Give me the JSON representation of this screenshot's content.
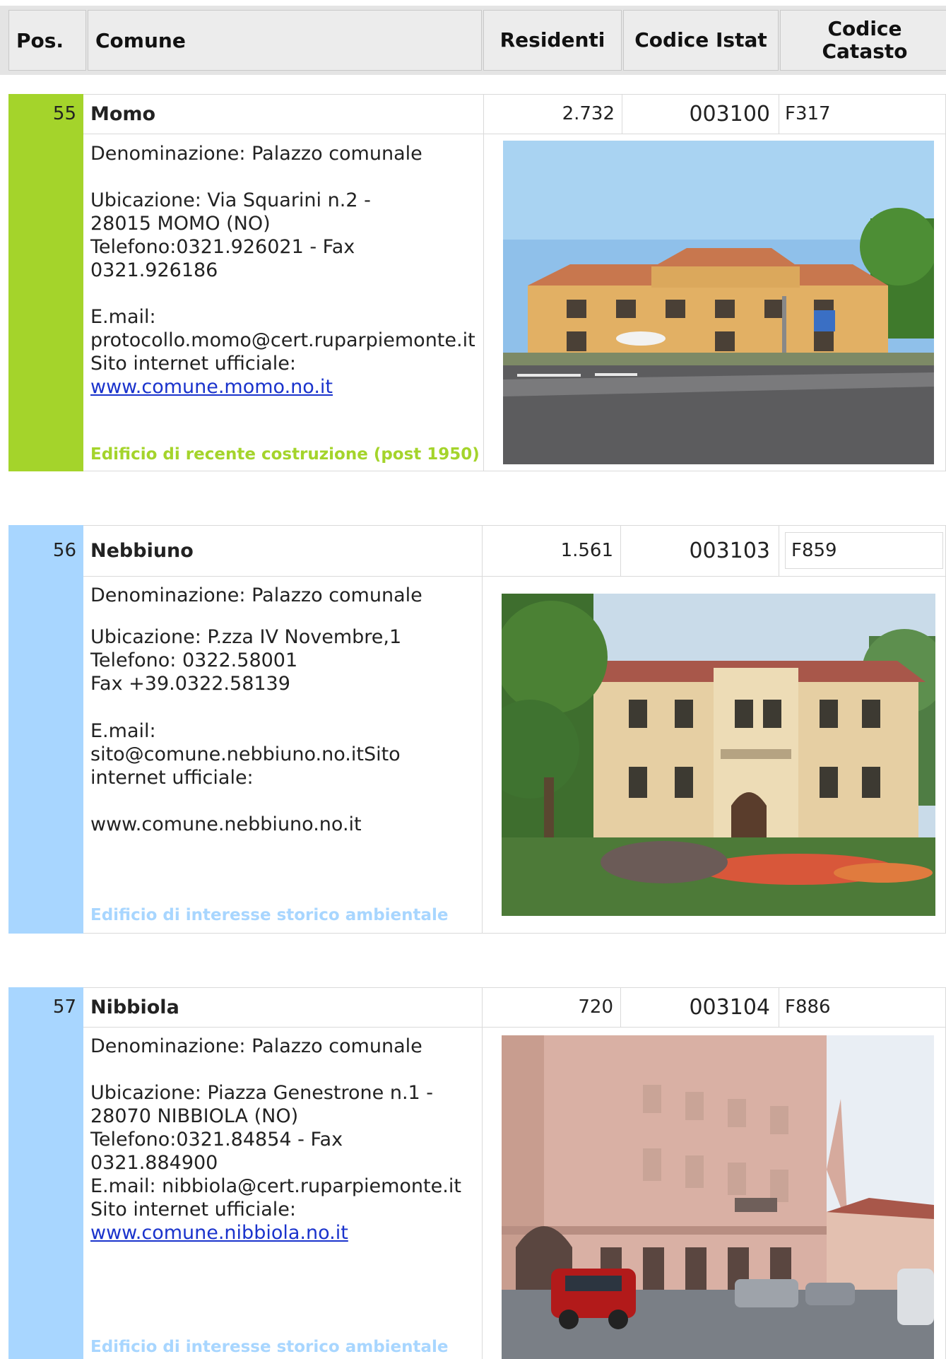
{
  "header": {
    "pos": "Pos.",
    "comune": "Comune",
    "residenti": "Residenti",
    "codice_istat": "Codice Istat",
    "codice_catasto": "Codice Catasto"
  },
  "colors": {
    "green": "#a4d42b",
    "blue": "#a8d6ff",
    "link": "#1a33cc"
  },
  "entries": [
    {
      "pos": "55",
      "name": "Momo",
      "residents": "2.732",
      "istat": "003100",
      "catasto": "F317",
      "denominazione": "Denominazione: Palazzo comunale",
      "ubicazione": "Ubicazione: Via Squarini n.2 -\n28015 MOMO (NO)\nTelefono:0321.926021 - Fax\n0321.926186",
      "email": "E.mail:\nprotocollo.momo@cert.ruparpiemonte.it\nSito internet ufficiale:",
      "website": "www.comune.momo.no.it",
      "tag": "Edificio di recente costruzione (post 1950)"
    },
    {
      "pos": "56",
      "name": "Nebbiuno",
      "residents": "1.561",
      "istat": "003103",
      "catasto": "F859",
      "denominazione": "Denominazione: Palazzo comunale",
      "ubicazione": "Ubicazione: P.zza IV Novembre,1\nTelefono: 0322.58001\nFax +39.0322.58139",
      "email": "E.mail:\nsito@comune.nebbiuno.no.itSito\ninternet ufficiale:",
      "website": "www.comune.nebbiuno.no.it",
      "tag": "Edificio di interesse storico ambientale"
    },
    {
      "pos": "57",
      "name": "Nibbiola",
      "residents": "720",
      "istat": "003104",
      "catasto": "F886",
      "denominazione": "Denominazione: Palazzo comunale",
      "ubicazione": "Ubicazione: Piazza Genestrone n.1 -\n28070 NIBBIOLA (NO)\nTelefono:0321.84854 - Fax\n0321.884900\nE.mail: nibbiola@cert.ruparpiemonte.it\nSito internet ufficiale:",
      "website": "www.comune.nibbiola.no.it",
      "tag": "Edificio di interesse storico ambientale"
    }
  ]
}
